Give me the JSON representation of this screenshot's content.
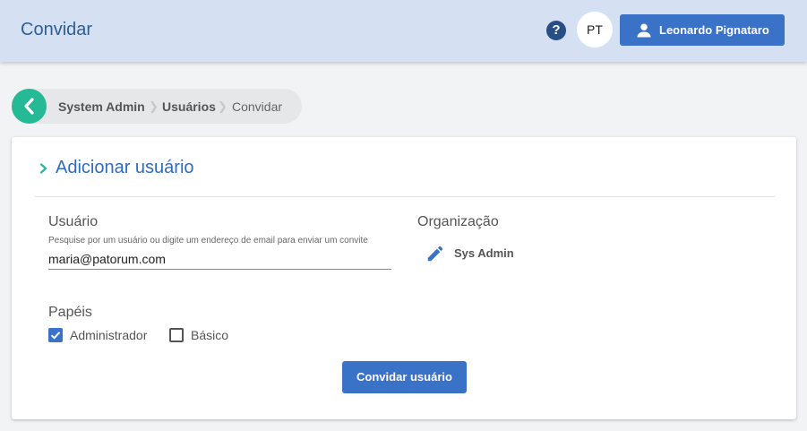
{
  "header": {
    "title": "Convidar",
    "help_icon": "?",
    "avatar_initials": "PT",
    "user_name": "Leonardo Pignataro",
    "user_icon": "person-icon",
    "background_color": "#d5e1f2",
    "accent_color": "#3a72c8"
  },
  "breadcrumb": {
    "back_icon": "chevron-left-icon",
    "back_color": "#26b995",
    "items": [
      "System Admin",
      "Usuários",
      "Convidar"
    ]
  },
  "form": {
    "section_title": "Adicionar usuário",
    "user": {
      "label": "Usuário",
      "hint": "Pesquise por um usuário ou digite um endereço de email para enviar um convite",
      "value": "maria@patorum.com"
    },
    "organization": {
      "label": "Organização",
      "edit_icon": "pencil-icon",
      "value": "Sys Admin"
    },
    "roles": {
      "label": "Papéis",
      "options": [
        {
          "label": "Administrador",
          "checked": true
        },
        {
          "label": "Básico",
          "checked": false
        }
      ]
    },
    "submit_label": "Convidar usuário"
  }
}
